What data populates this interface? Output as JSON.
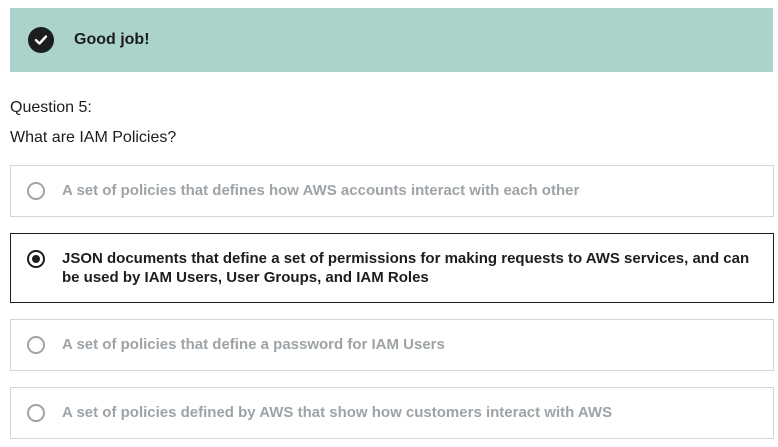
{
  "banner": {
    "icon": "check-circle-icon",
    "text": "Good job!",
    "background": "#acd2cc"
  },
  "question": {
    "number_label": "Question 5:",
    "text": "What are IAM Policies?"
  },
  "options": [
    {
      "label": "A set of policies that defines how AWS accounts interact with each other",
      "selected": false
    },
    {
      "label": "JSON documents that define a set of permissions for making requests to AWS services, and can be used by IAM Users, User Groups, and IAM Roles",
      "selected": true
    },
    {
      "label": "A set of policies that define a password for IAM Users",
      "selected": false
    },
    {
      "label": "A set of policies defined by AWS that show how customers interact with AWS",
      "selected": false
    }
  ]
}
